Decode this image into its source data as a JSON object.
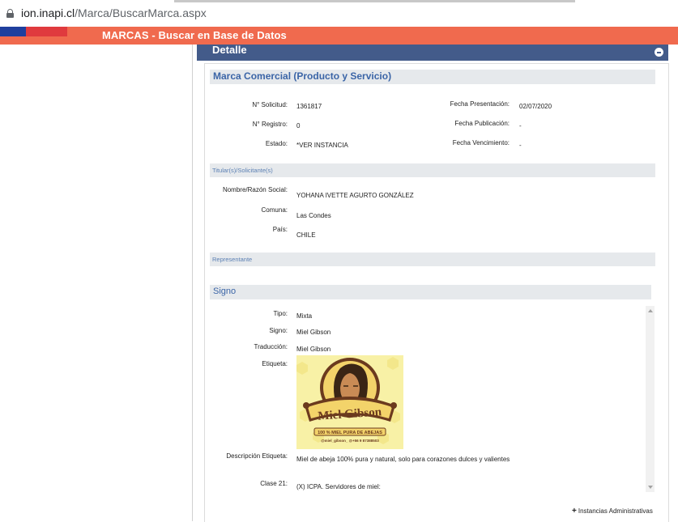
{
  "browser": {
    "url_host": "ion.inapi.cl",
    "url_path": "/Marca/BuscarMarca.aspx"
  },
  "header": {
    "title": "MARCAS - Buscar en Base de Datos"
  },
  "detalle": {
    "title": "Detalle"
  },
  "marca": {
    "section_title": "Marca Comercial (Producto y Servicio)",
    "solicitud_label": "N° Solicitud:",
    "solicitud_value": "1361817",
    "registro_label": "N° Registro:",
    "registro_value": "0",
    "estado_label": "Estado:",
    "estado_value": "*VER INSTANCIA",
    "fecha_presentacion_label": "Fecha Presentación:",
    "fecha_presentacion_value": "02/07/2020",
    "fecha_publicacion_label": "Fecha Publicación:",
    "fecha_publicacion_value": "-",
    "fecha_vencimiento_label": "Fecha Vencimiento:",
    "fecha_vencimiento_value": "-"
  },
  "titular": {
    "section_title": "Titular(s)/Solicitante(s)",
    "nombre_label": "Nombre/Razón Social:",
    "nombre_value": "YOHANA IVETTE AGURTO GONZÁLEZ",
    "comuna_label": "Comuna:",
    "comuna_value": "Las Condes",
    "pais_label": "País:",
    "pais_value": "CHILE"
  },
  "representante": {
    "section_title": "Representante"
  },
  "signo": {
    "section_title": "Signo",
    "tipo_label": "Tipo:",
    "tipo_value": "Mixta",
    "signo_label": "Signo:",
    "signo_value": "Miel Gibson",
    "traduccion_label": "Traducción:",
    "traduccion_value": "Miel Gibson",
    "etiqueta_label": "Etiqueta:",
    "logo_text": "Miel Gibson",
    "logo_tagline": "100 % MIEL PURA DE ABEJAS",
    "logo_contact": "@miel_gibson_  @+56 9 87388503",
    "descripcion_label": "Descripción Etiqueta:",
    "descripcion_value": "Miel de abeja 100% pura y natural, solo para corazones dulces y valientes",
    "clase_label": "Clase 21:",
    "clase_value": "(X) ICPA. Servidores de miel:"
  },
  "footer": {
    "instancias_label": "Instancias Administrativas"
  },
  "colors": {
    "header_bg": "#f06a4e",
    "detalle_bg": "#435b8a",
    "section_title": "#3b65a7"
  }
}
